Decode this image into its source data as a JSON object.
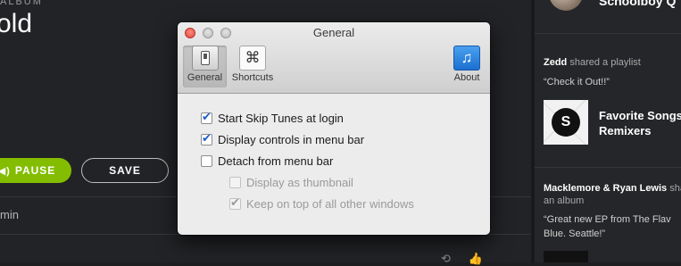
{
  "background_app": {
    "album_label": "ALBUM",
    "album_title": "old",
    "pause_button": "PAUSE",
    "save_button": "SAVE",
    "duration_text": "min",
    "pause_color": "#84bd00"
  },
  "feed": {
    "top_name": "Schoolboy Q",
    "item1": {
      "user": "Zedd",
      "action": " shared a playlist",
      "quote": "“Check it Out!!”",
      "playlist_title_line1": "Favorite Songs",
      "playlist_title_line2": "Remixers"
    },
    "item2": {
      "user": "Macklemore & Ryan Lewis",
      "action": " shared",
      "action_line2": "an album",
      "quote_line1": "“Great new EP from The Flav",
      "quote_line2": "Blue. Seattle!”"
    }
  },
  "window": {
    "title": "General",
    "toolbar": {
      "general": "General",
      "shortcuts": "Shortcuts",
      "about": "About",
      "selected": "General"
    },
    "options": [
      {
        "label": "Start Skip Tunes at login",
        "checked": true,
        "enabled": true
      },
      {
        "label": "Display controls in menu bar",
        "checked": true,
        "enabled": true
      },
      {
        "label": "Detach from menu bar",
        "checked": false,
        "enabled": true
      },
      {
        "label": "Display as thumbnail",
        "checked": false,
        "enabled": false
      },
      {
        "label": "Keep on top of all other windows",
        "checked": true,
        "enabled": false
      }
    ]
  }
}
